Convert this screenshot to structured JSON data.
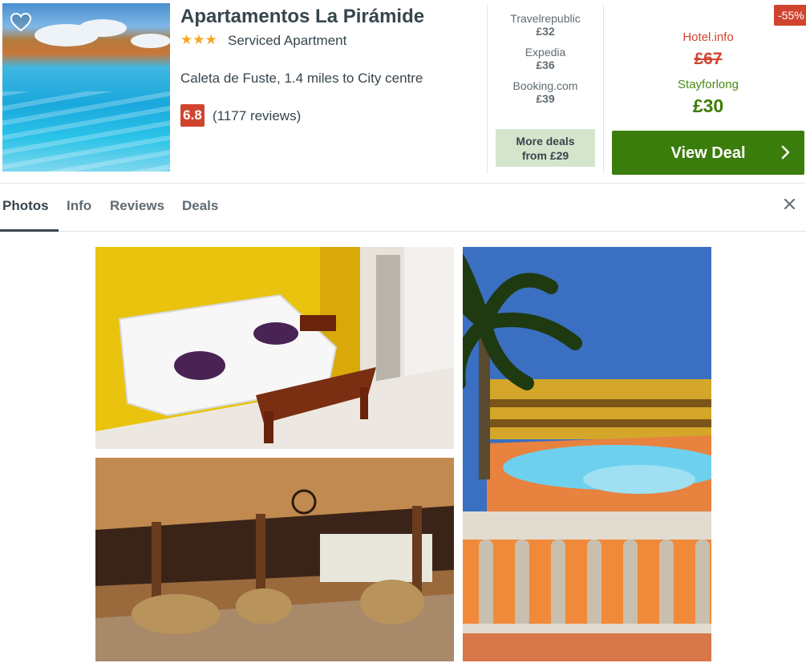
{
  "hotel": {
    "name": "Apartamentos La Pirámide",
    "stars": "★★★",
    "type": "Serviced Apartment",
    "location": "Caleta de Fuste, 1.4 miles to City centre",
    "rating": "6.8",
    "reviews": "(1177 reviews)"
  },
  "providers": [
    {
      "name": "Travelrepublic",
      "price": "£32"
    },
    {
      "name": "Expedia",
      "price": "£36"
    },
    {
      "name": "Booking.com",
      "price": "£39"
    }
  ],
  "more_deals": {
    "line1": "More deals",
    "line2": "from £29"
  },
  "deal": {
    "discount": "-55%",
    "compare_provider": "Hotel.info",
    "compare_price": "£67",
    "provider": "Stayforlong",
    "price": "£30",
    "button_label": "View Deal"
  },
  "tabs": [
    {
      "label": "Photos"
    },
    {
      "label": "Info"
    },
    {
      "label": "Reviews"
    },
    {
      "label": "Deals"
    }
  ],
  "icons": {
    "favorite": "heart-icon",
    "close": "close-icon",
    "chevron": "chevron-right-icon"
  },
  "colors": {
    "rating": "#d0442f",
    "deal_green": "#3b7d0c",
    "more_deals_bg": "#d5e5cc",
    "stars": "#f5a623"
  }
}
